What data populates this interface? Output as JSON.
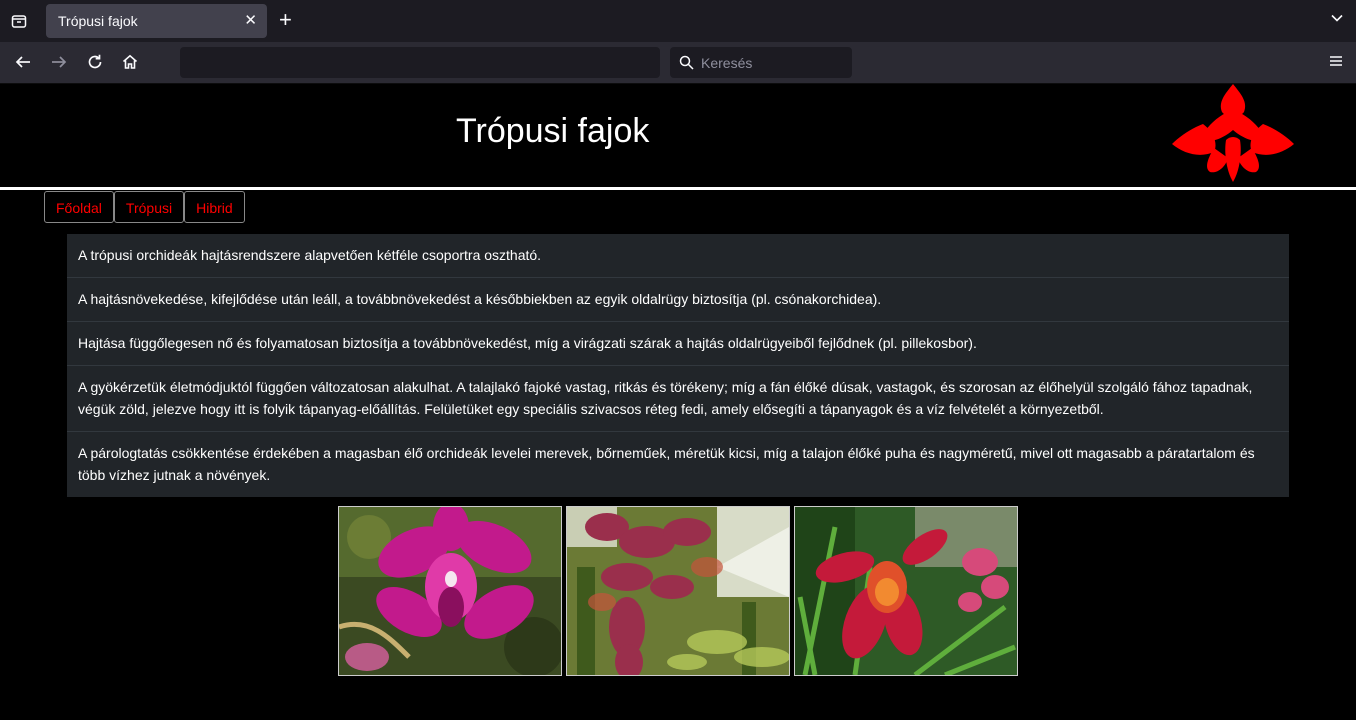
{
  "browser": {
    "tab_title": "Trópusi fajok",
    "search_placeholder": "Keresés",
    "url": ""
  },
  "page": {
    "title": "Trópusi fajok",
    "nav": [
      "Főoldal",
      "Trópusi",
      "Hibrid"
    ],
    "paragraphs": [
      "A trópusi orchideák hajtásrendszere alapvetően kétféle csoportra osztható.",
      "A hajtásnövekedése, kifejlődése után leáll, a továbbnövekedést a későbbiekben az egyik oldalrügy biztosítja (pl. csónakorchidea).",
      "Hajtása függőlegesen nő és folyamatosan biztosítja a továbbnövekedést, míg a virágzati szárak a hajtás oldalrügyeiből fejlődnek (pl. pillekosbor).",
      "A gyökérzetük életmódjuktól függően változatosan alakulhat. A talajlakó fajoké vastag, ritkás és törékeny; míg a fán élőké dúsak, vastagok, és szorosan az élőhelyül szolgáló fához tapadnak, végük zöld, jelezve hogy itt is folyik tápanyag-előállítás. Felületüket egy speciális szivacsos réteg fedi, amely elősegíti a tápanyagok és a víz felvételét a környezetből.",
      "A párologtatás csökkentése érdekében a magasban élő orchideák levelei merevek, bőrneműek, méretük kicsi, míg a talajon élőké puha és nagyméretű, mivel ott magasabb a páratartalom és több vízhez jutnak a növények."
    ]
  },
  "colors": {
    "link": "#ff0000",
    "logo": "#ff0000",
    "panel": "#212529"
  }
}
